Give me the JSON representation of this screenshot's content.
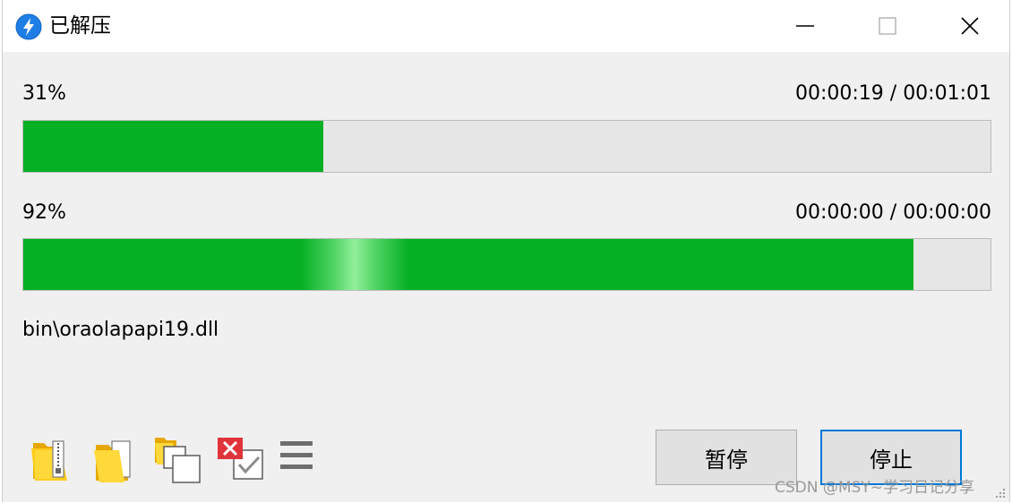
{
  "window": {
    "title": "已解压",
    "app_icon": "lightning-bolt-icon"
  },
  "progress": {
    "total": {
      "percent_text": "31%",
      "fraction": 0.31,
      "time_text": "00:00:19 / 00:01:01"
    },
    "current": {
      "percent_text": "92%",
      "fraction": 0.92,
      "time_text": "00:00:00 / 00:00:00"
    }
  },
  "current_file": "bin\\oraolapapi19.dll",
  "toolbar": {
    "icons": [
      "zip-folder-icon",
      "open-folder-icon",
      "copy-window-icon",
      "delete-check-icon",
      "menu-icon"
    ]
  },
  "buttons": {
    "pause": "暂停",
    "stop": "停止"
  },
  "watermark": "CSDN @MSY~学习日记分享",
  "colors": {
    "progress_fill": "#06b025",
    "focus_border": "#0078d7",
    "app_icon_blue": "#1e7ee6"
  }
}
